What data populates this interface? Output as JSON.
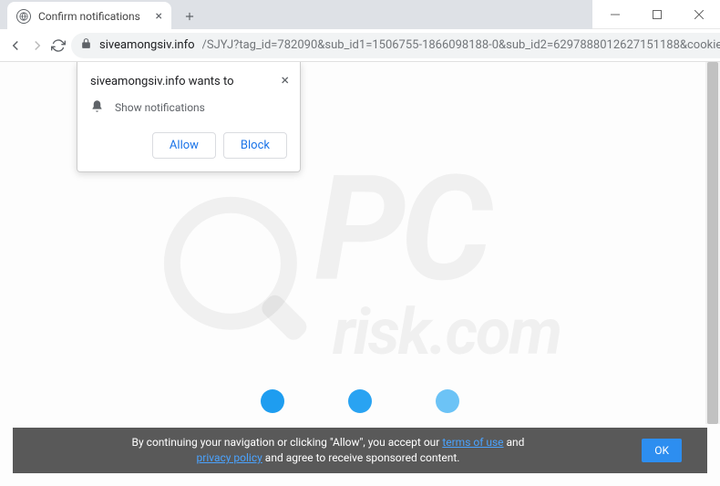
{
  "window": {
    "tab_title": "Confirm notifications"
  },
  "address": {
    "host": "siveamongsiv.info",
    "path": "/SJYJ?tag_id=782090&sub_id1=1506755-1866098188-0&sub_id2=6297888012627151188&cookie_id=754..."
  },
  "permission": {
    "title": "siveamongsiv.info wants to",
    "item": "Show notifications",
    "allow": "Allow",
    "block": "Block"
  },
  "cookie": {
    "pre": "By continuing your navigation or clicking \"Allow\", you accept our ",
    "terms": "terms of use",
    "mid": " and ",
    "privacy": "privacy policy",
    "post": " and agree to receive sponsored content.",
    "ok": "OK"
  },
  "watermark": {
    "main": "PC",
    "sub": "risk.com"
  }
}
